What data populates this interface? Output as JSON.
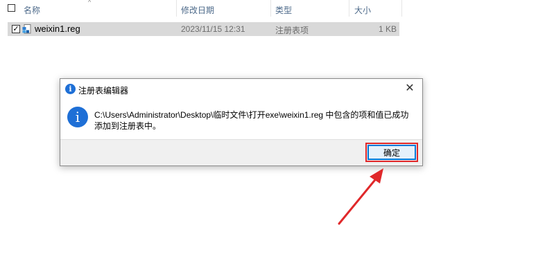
{
  "explorer": {
    "columns": {
      "name": "名称",
      "date": "修改日期",
      "type": "类型",
      "size": "大小"
    },
    "sort_indicator": "^",
    "file": {
      "checked": "✓",
      "name": "weixin1.reg",
      "date": "2023/11/15 12:31",
      "type": "注册表项",
      "size": "1 KB"
    }
  },
  "dialog": {
    "title": "注册表编辑器",
    "title_icon_glyph": "i",
    "info_icon_glyph": "i",
    "message_line1": "C:\\Users\\Administrator\\Desktop\\临时文件\\打开exe\\weixin1.reg 中包含的项和值已成功",
    "message_line2": "添加到注册表中。",
    "close_glyph": "✕",
    "ok_label": "确定"
  },
  "colors": {
    "accent": "#0078d7",
    "info": "#1e6fd6",
    "annotation": "#e0282a"
  }
}
